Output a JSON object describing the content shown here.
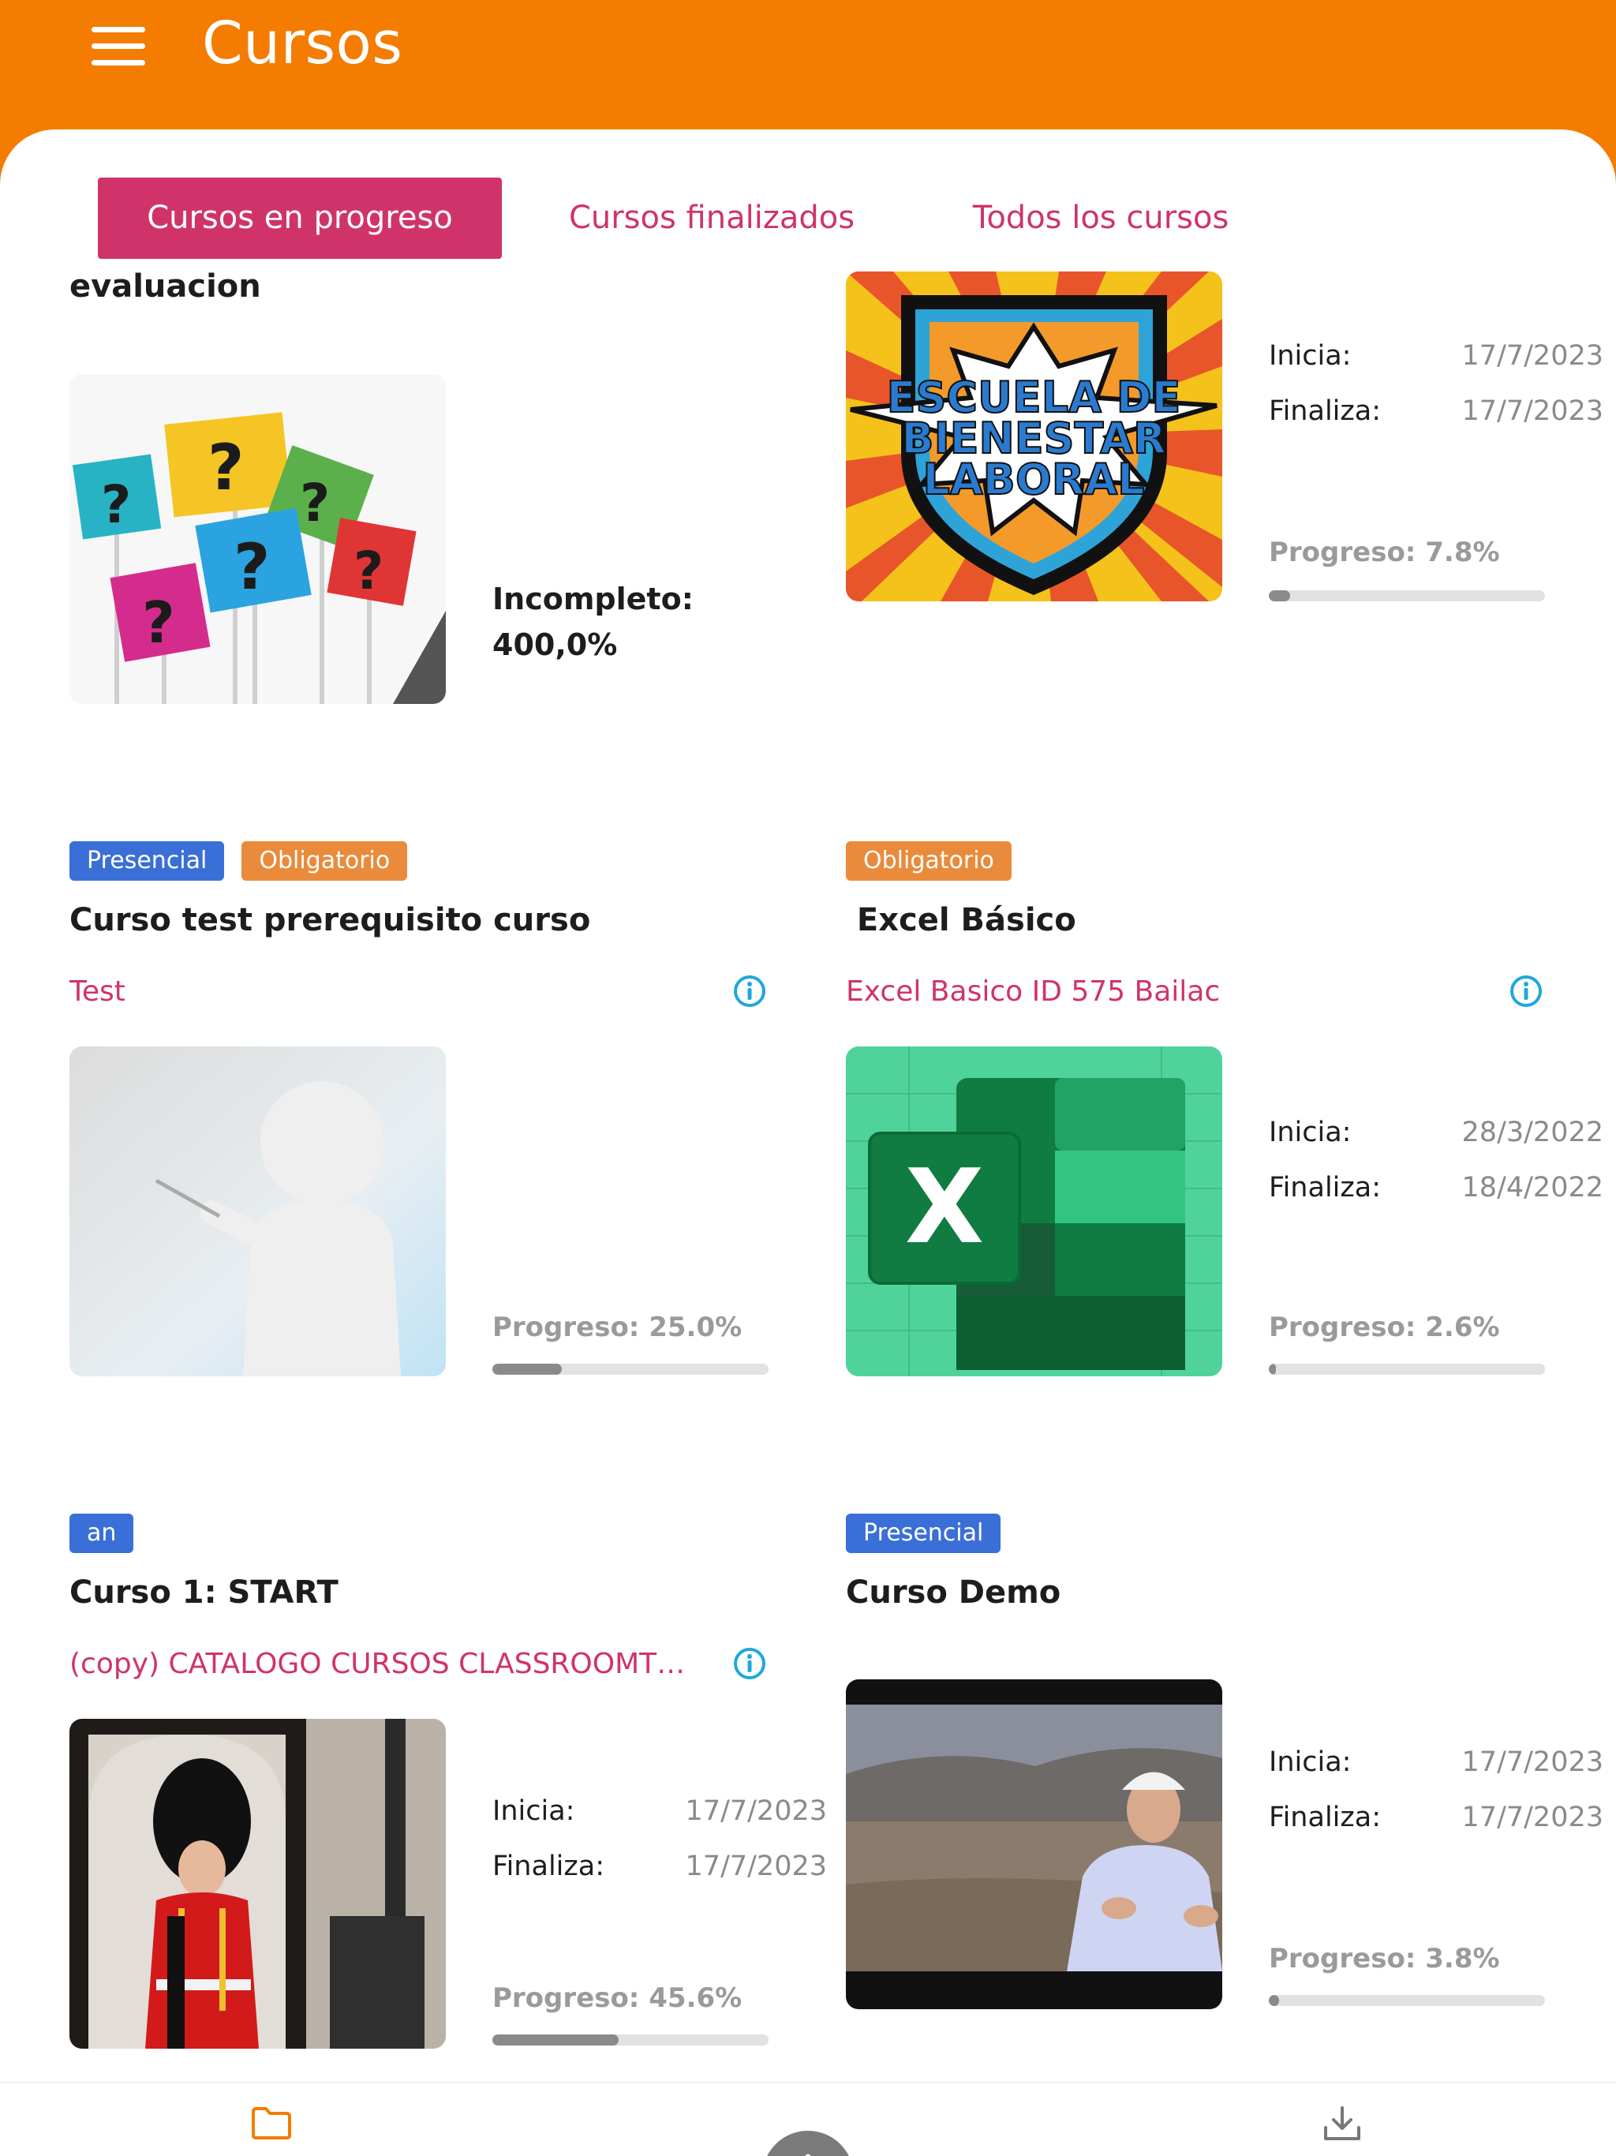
{
  "app": {
    "title": "Cursos"
  },
  "tabs": [
    {
      "label": "Cursos en progreso",
      "active": true
    },
    {
      "label": "Cursos finalizados",
      "active": false
    },
    {
      "label": "Todos los cursos",
      "active": false
    }
  ],
  "labels": {
    "inicia": "Inicia:",
    "finaliza": "Finaliza:"
  },
  "courses": [
    {
      "title": "evaluacion",
      "status_line1": "Incompleto:",
      "status_line2": "400,0%",
      "image": "question-marks-signs"
    },
    {
      "image": "escuela-de-bienestar-laboral-logo",
      "image_text": [
        "ESCUELA DE",
        "BIENESTAR",
        "LABORAL"
      ],
      "start": "17/7/2023",
      "end": "17/7/2023",
      "progress_label": "Progreso: 7.8%",
      "progress": 7.8
    },
    {
      "badges": [
        {
          "label": "Presencial",
          "color": "#3A6FD8"
        },
        {
          "label": "Obligatorio",
          "color": "#E98B3B"
        }
      ],
      "title": "Curso test prerequisito curso",
      "subtitle": "Test",
      "image": "presenter-placeholder",
      "progress_label": "Progreso: 25.0%",
      "progress": 25.0
    },
    {
      "badges": [
        {
          "label": "Obligatorio",
          "color": "#E98B3B"
        }
      ],
      "title": " Excel Básico",
      "subtitle": "Excel Basico ID 575 Bailac",
      "image": "excel-logo",
      "start": "28/3/2022",
      "end": "18/4/2022",
      "progress_label": "Progreso: 2.6%",
      "progress": 2.6
    },
    {
      "badges": [
        {
          "label": "an",
          "color": "#3A6FD8"
        }
      ],
      "title": "Curso 1: START",
      "subtitle": "(copy) CATALOGO CURSOS CLASSROOMTV, C...",
      "image": "royal-guard-photo",
      "start": "17/7/2023",
      "end": "17/7/2023",
      "progress_label": "Progreso: 45.6%",
      "progress": 45.6
    },
    {
      "badges": [
        {
          "label": "Presencial",
          "color": "#3A6FD8"
        }
      ],
      "title": "Curso Demo",
      "image": "engineer-video-still",
      "start": "17/7/2023",
      "end": "17/7/2023",
      "progress_label": "Progreso: 3.8%",
      "progress": 3.8
    }
  ],
  "bottom_nav": [
    {
      "icon": "folder-icon",
      "active": true,
      "color": "#F47C00"
    },
    {
      "icon": "home-icon",
      "active": false
    },
    {
      "icon": "download-icon",
      "active": false
    }
  ],
  "colors": {
    "brand": "#F47C00",
    "accent": "#D0336A",
    "info": "#20A7DC"
  }
}
